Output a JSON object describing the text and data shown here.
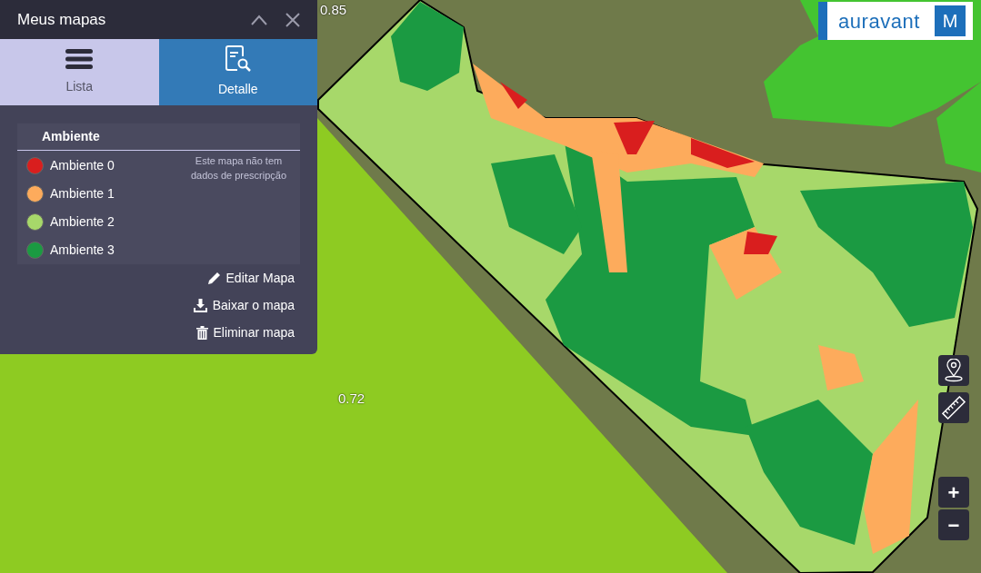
{
  "panel": {
    "title": "Meus mapas"
  },
  "tabs": [
    {
      "label": "Lista",
      "selected": false,
      "kind": "list"
    },
    {
      "label": "Detalle",
      "selected": true,
      "kind": "detail"
    }
  ],
  "legend": {
    "heading": "Ambiente",
    "items": [
      {
        "label": "Ambiente 0",
        "color": "#d91e1e"
      },
      {
        "label": "Ambiente 1",
        "color": "#fdab5c"
      },
      {
        "label": "Ambiente 2",
        "color": "#a7d86a"
      },
      {
        "label": "Ambiente 3",
        "color": "#1b9a42"
      }
    ],
    "note": "Este mapa não tem dados de prescripção"
  },
  "actions": [
    {
      "label": "Editar Mapa",
      "kind": "edit"
    },
    {
      "label": "Baixar o mapa",
      "kind": "download"
    },
    {
      "label": "Eliminar mapa",
      "kind": "delete"
    }
  ],
  "map": {
    "labels": [
      "0.85",
      "0.72"
    ]
  },
  "logo": {
    "text": "auravant",
    "badge": "M"
  },
  "map_tools": [
    {
      "kind": "pin"
    },
    {
      "kind": "ruler"
    },
    {
      "kind": "zoom_in",
      "label": "+"
    },
    {
      "kind": "zoom_out",
      "label": "−"
    }
  ]
}
